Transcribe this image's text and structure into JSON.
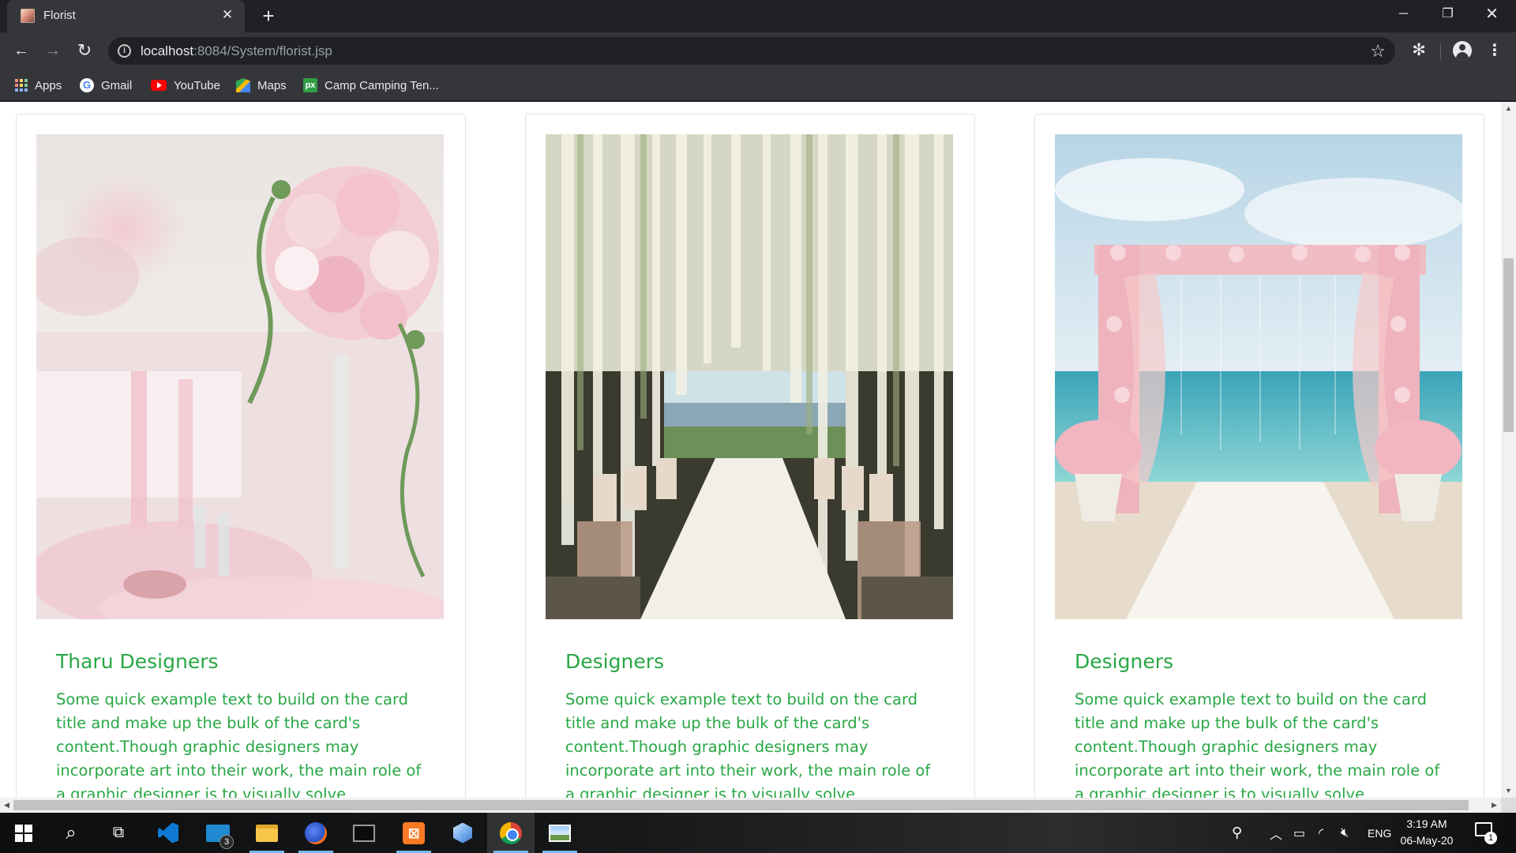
{
  "browser": {
    "tab_title": "Florist",
    "url_host": "localhost",
    "url_path": ":8084/System/florist.jsp",
    "bookmarks": [
      {
        "label": "Apps",
        "icon": "apps-icon"
      },
      {
        "label": "Gmail",
        "icon": "google-icon"
      },
      {
        "label": "YouTube",
        "icon": "youtube-icon"
      },
      {
        "label": "Maps",
        "icon": "maps-icon"
      },
      {
        "label": "Camp Camping Ten...",
        "icon": "px-icon"
      }
    ]
  },
  "cards": [
    {
      "title": "Tharu Designers",
      "text": "Some quick example text to build on the card title and make up the bulk of the card's content.Though graphic designers may incorporate art into their work, the main role of a graphic designer is to visually solve communication problems using design",
      "image": "wedding-table-flowers"
    },
    {
      "title": "Designers",
      "text": "Some quick example text to build on the card title and make up the bulk of the card's content.Though graphic designers may incorporate art into their work, the main role of a graphic designer is to visually solve communication problems using design",
      "image": "wisteria-aisle"
    },
    {
      "title": "Designers",
      "text": "Some quick example text to build on the card title and make up the bulk of the card's content.Though graphic designers may incorporate art into their work, the main role of a graphic designer is to visually solve communication problems using design",
      "image": "beach-flower-arch"
    }
  ],
  "taskbar": {
    "mail_badge": "3",
    "language": "ENG",
    "time": "3:19 AM",
    "date": "06-May-20",
    "notification_count": "1"
  },
  "colors": {
    "accent_green": "#28a745",
    "chrome_dark": "#202124",
    "chrome_toolbar": "#35363a"
  }
}
